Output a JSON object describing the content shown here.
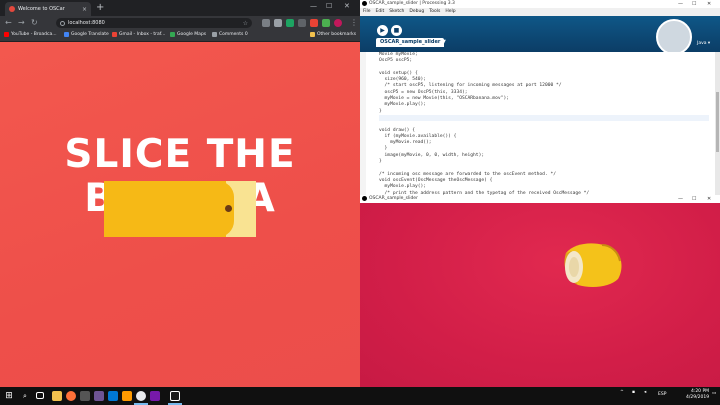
{
  "chrome": {
    "tab_title": "Welcome to OSCar",
    "tab_close": "×",
    "new_tab": "+",
    "url": "localhost:8080",
    "back": "←",
    "forward": "→",
    "reload": "↻",
    "star": "☆",
    "menu": "⋮",
    "minimize": "—",
    "maximize": "☐",
    "close": "✕",
    "bookmarks": [
      {
        "label": "YouTube - Broadca...",
        "color": "#ff0000"
      },
      {
        "label": "Google Translate",
        "color": "#4285f4"
      },
      {
        "label": "Gmail - Inbox - traf...",
        "color": "#ea4335"
      },
      {
        "label": "Google Maps",
        "color": "#34a853"
      },
      {
        "label": "Comments 0",
        "color": "#9aa0a6"
      }
    ],
    "other_bookmarks": "Other bookmarks"
  },
  "page": {
    "headline_line1": "SLICE THE",
    "headline_line2": "BANANA",
    "slider_value_fraction": 0.8
  },
  "ide": {
    "title": "OSCAR_sample_slider | Processing 3.3",
    "menu": [
      "File",
      "Edit",
      "Sketch",
      "Debug",
      "Tools",
      "Help"
    ],
    "run": "▶",
    "stop": "■",
    "tab": "OSCAR_sample_slider",
    "tab_arrow": "▼",
    "mode": "Java ▾",
    "code": [
      "Movie myMovie;",
      "OscP5 oscP5;",
      "",
      "void setup() {",
      "  size(960, 540);",
      "  /* start oscP5, listening for incoming messages at port 12000 */",
      "  oscP5 = new OscP5(this, 3334);",
      "  myMovie = new Movie(this, \"OSCARbanana.mov\");",
      "  myMovie.play();",
      "}",
      "",
      "",
      "void draw() {",
      "  if (myMovie.available()) {",
      "    myMovie.read();",
      "  }",
      "  image(myMovie, 0, 0, width, height);",
      "}",
      "",
      "/* incoming osc message are forwarded to the oscEvent method. */",
      "void oscEvent(OscMessage theOscMessage) {",
      "  myMovie.play();",
      "  /* print the address pattern and the typetag of the received OscMessage */",
      "  //print(\"### received an osc message.\");"
    ],
    "highlight_line": 10
  },
  "sketch": {
    "title": "OSCAR_sample_slider"
  },
  "taskbar": {
    "start": "⊞",
    "search": "⌕",
    "tray_lang": "ESP",
    "time": "4:20 PM",
    "date": "4/29/2019",
    "apps": [
      {
        "name": "file-explorer",
        "color": "#f2c14e"
      },
      {
        "name": "firefox",
        "color": "#ff7139"
      },
      {
        "name": "terminal",
        "color": "#555555"
      },
      {
        "name": "github",
        "color": "#6e5494"
      },
      {
        "name": "vscode",
        "color": "#0078d4"
      },
      {
        "name": "illustrator",
        "color": "#ff9a00"
      },
      {
        "name": "chrome",
        "color": "#e8eaed"
      },
      {
        "name": "onenote",
        "color": "#7719aa"
      },
      {
        "name": "processing",
        "color": "#1b1b1b"
      }
    ]
  }
}
